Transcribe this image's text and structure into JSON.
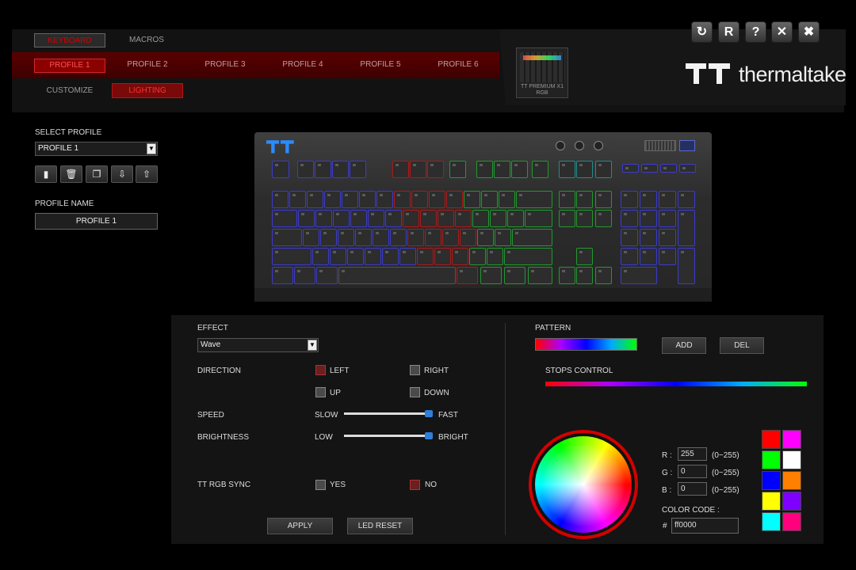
{
  "nav": {
    "main_tabs": [
      {
        "label": "KEYBOARD",
        "active": true
      },
      {
        "label": "MACROS",
        "active": false
      }
    ],
    "profiles": [
      {
        "label": "PROFILE 1",
        "active": true
      },
      {
        "label": "PROFILE 2",
        "active": false
      },
      {
        "label": "PROFILE 3",
        "active": false
      },
      {
        "label": "PROFILE 4",
        "active": false
      },
      {
        "label": "PROFILE 5",
        "active": false
      },
      {
        "label": "PROFILE 6",
        "active": false
      }
    ],
    "sub_tabs": [
      {
        "label": "CUSTOMIZE",
        "active": false
      },
      {
        "label": "LIGHTING",
        "active": true
      }
    ]
  },
  "device": {
    "name_line1": "TT PREMIUM X1",
    "name_line2": "RGB"
  },
  "brand": {
    "name": "thermaltake",
    "mark": "TT"
  },
  "window_buttons": [
    {
      "name": "refresh-icon",
      "glyph": "↻"
    },
    {
      "name": "reset-icon",
      "glyph": "R"
    },
    {
      "name": "help-icon",
      "glyph": "?"
    },
    {
      "name": "close-icon",
      "glyph": "✕"
    },
    {
      "name": "settings-icon",
      "glyph": "✖"
    }
  ],
  "left": {
    "select_profile_label": "SELECT PROFILE",
    "select_profile_value": "PROFILE 1",
    "profile_actions": [
      {
        "name": "new-profile-icon",
        "glyph": "▮"
      },
      {
        "name": "delete-profile-icon",
        "glyph": "🗑"
      },
      {
        "name": "copy-profile-icon",
        "glyph": "❐"
      },
      {
        "name": "import-profile-icon",
        "glyph": "⇩"
      },
      {
        "name": "export-profile-icon",
        "glyph": "⇧"
      }
    ],
    "profile_name_label": "PROFILE NAME",
    "profile_name_value": "PROFILE 1"
  },
  "effect": {
    "label": "EFFECT",
    "value": "Wave",
    "direction_label": "DIRECTION",
    "directions": {
      "left": "LEFT",
      "right": "RIGHT",
      "up": "UP",
      "down": "DOWN"
    },
    "direction_selected": "left",
    "speed_label": "SPEED",
    "speed_min": "SLOW",
    "speed_max": "FAST",
    "speed_value": 1.0,
    "brightness_label": "BRIGHTNESS",
    "brightness_min": "LOW",
    "brightness_max": "BRIGHT",
    "brightness_value": 1.0,
    "sync_label": "TT RGB SYNC",
    "sync_yes": "YES",
    "sync_no": "NO",
    "sync_selected": "no",
    "apply": "APPLY",
    "led_reset": "LED RESET"
  },
  "pattern": {
    "label": "PATTERN",
    "add": "ADD",
    "del": "DEL",
    "stops_label": "STOPS CONTROL"
  },
  "color": {
    "r_label": "R :",
    "g_label": "G :",
    "b_label": "B :",
    "r": "255",
    "g": "0",
    "b": "0",
    "range": "(0~255)",
    "code_label": "COLOR CODE :",
    "hash": "#",
    "code": "ff0000",
    "swatches": [
      "#ff0000",
      "#ff00ff",
      "#00ff00",
      "#ffffff",
      "#0000ff",
      "#ff7f00",
      "#ffff00",
      "#7f00ff",
      "#00ffff",
      "#ff007f"
    ]
  }
}
